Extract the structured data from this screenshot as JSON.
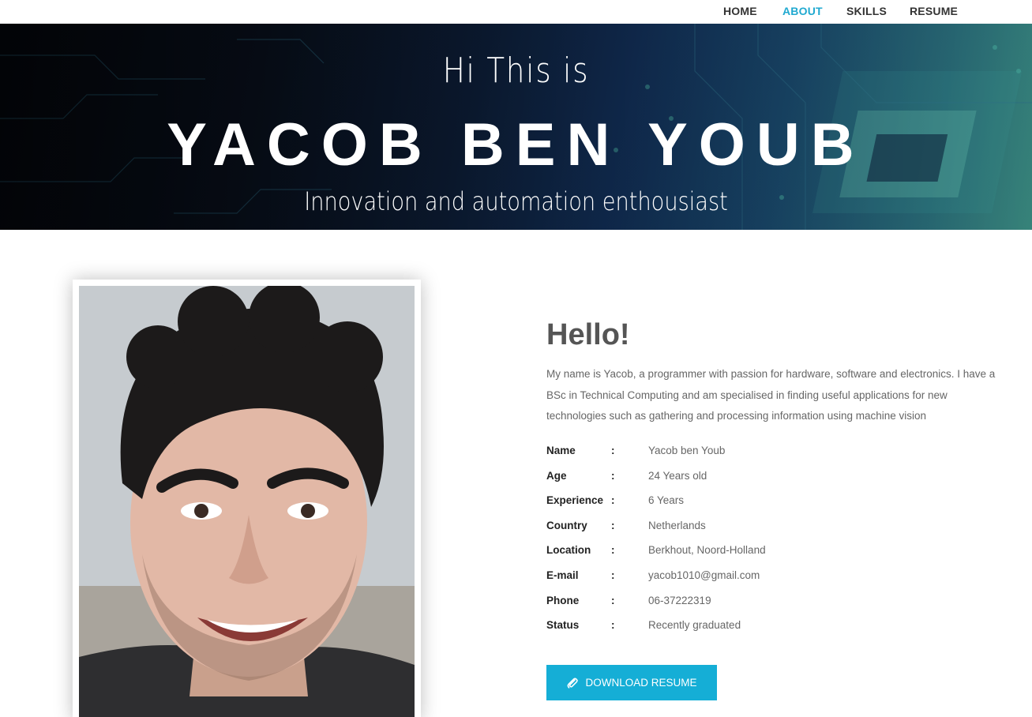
{
  "nav": {
    "items": [
      {
        "label": "HOME",
        "active": false
      },
      {
        "label": "ABOUT",
        "active": true
      },
      {
        "label": "SKILLS",
        "active": false
      },
      {
        "label": "RESUME",
        "active": false
      }
    ],
    "active_color": "#20a9d0"
  },
  "hero": {
    "greeting": "Hi This is",
    "name": "YACOB BEN YOUB",
    "tagline": "Innovation and automation enthousiast"
  },
  "about": {
    "heading": "Hello!",
    "bio": "My name is Yacob, a programmer with passion for hardware, software and electronics. I have a BSc in Technical Computing and am specialised in finding useful applications for new technologies such as gathering and processing information using machine vision",
    "separator": ":",
    "details": [
      {
        "key": "Name",
        "value": "Yacob ben Youb"
      },
      {
        "key": "Age",
        "value": "24 Years old"
      },
      {
        "key": "Experience",
        "value": "6 Years"
      },
      {
        "key": "Country",
        "value": "Netherlands"
      },
      {
        "key": "Location",
        "value": "Berkhout, Noord-Holland"
      },
      {
        "key": "E-mail",
        "value": "yacob1010@gmail.com"
      },
      {
        "key": "Phone",
        "value": "06-37222319"
      },
      {
        "key": "Status",
        "value": "Recently graduated"
      }
    ],
    "download_label": "DOWNLOAD RESUME",
    "download_icon": "paperclip-icon",
    "button_color": "#15aed6"
  },
  "profile_photo": {
    "alt": "profile-photo"
  }
}
